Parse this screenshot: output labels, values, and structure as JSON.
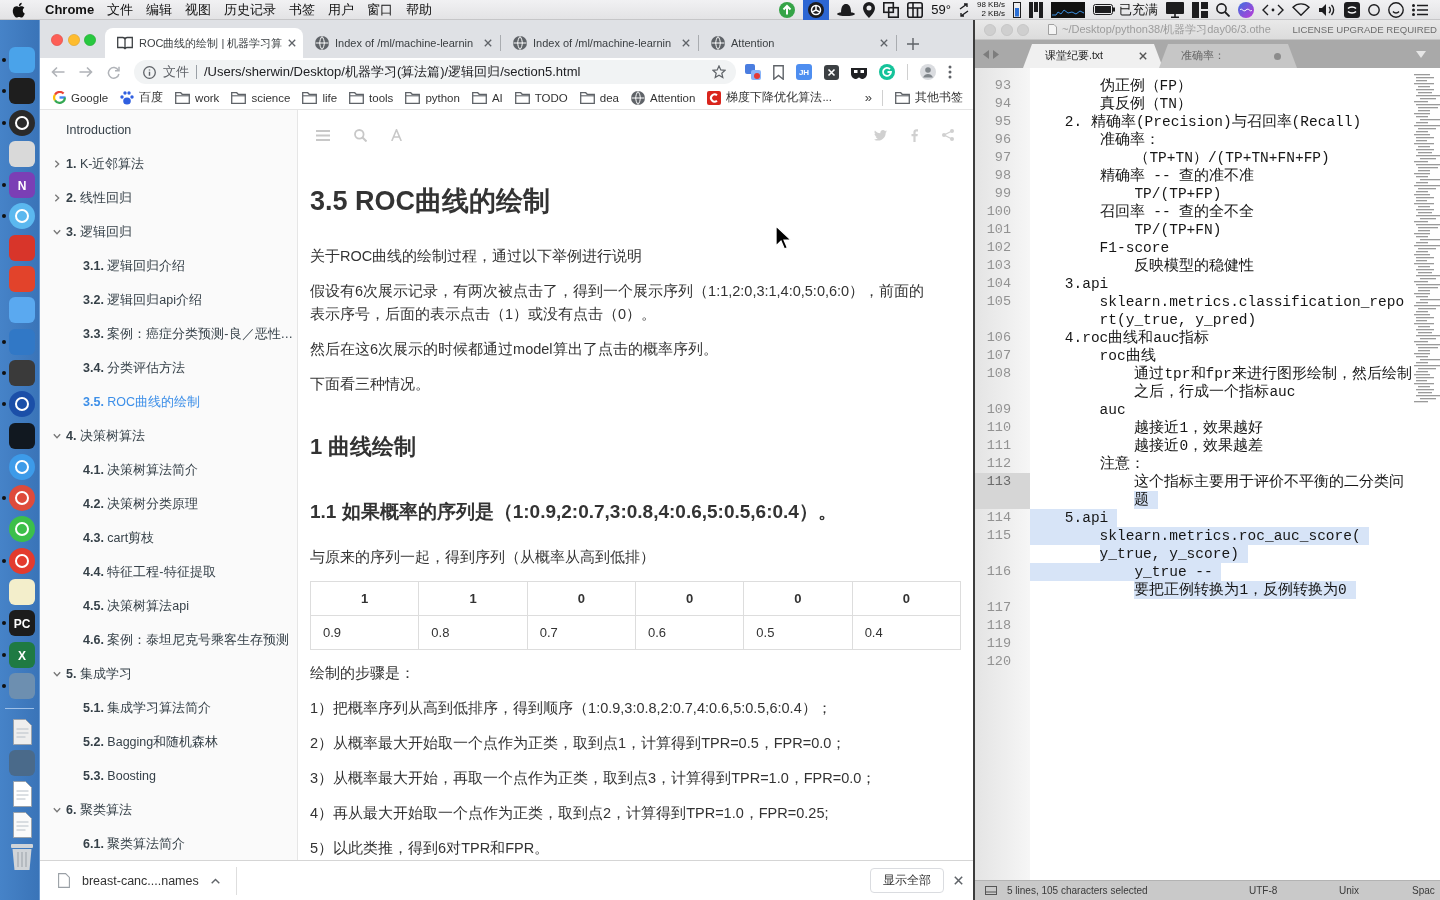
{
  "menubar": {
    "app": "Chrome",
    "menus": [
      "文件",
      "编辑",
      "视图",
      "历史记录",
      "书签",
      "用户",
      "窗口",
      "帮助"
    ],
    "status_items": [
      {
        "kind": "upload",
        "selected": false
      },
      {
        "kind": "aperture",
        "selected": true
      },
      {
        "kind": "hat",
        "selected": false
      },
      {
        "kind": "pin",
        "selected": false
      },
      {
        "kind": "windows",
        "selected": false
      },
      {
        "kind": "grid",
        "selected": false
      },
      {
        "kind": "temperature",
        "text": "59°",
        "selected": false
      },
      {
        "kind": "arrows",
        "selected": false
      },
      {
        "kind": "netspeed",
        "lines": [
          "98 KB/s",
          "2 KB/s"
        ],
        "selected": false
      },
      {
        "kind": "memory",
        "selected": false
      },
      {
        "kind": "bars",
        "selected": false
      },
      {
        "kind": "cpu",
        "selected": false
      },
      {
        "kind": "battery",
        "text": "已充满",
        "selected": false
      },
      {
        "kind": "display",
        "selected": false
      },
      {
        "kind": "layout",
        "selected": false
      },
      {
        "kind": "search",
        "selected": false
      },
      {
        "kind": "orb",
        "selected": false
      },
      {
        "kind": "code",
        "selected": false
      },
      {
        "kind": "wifi",
        "selected": false
      },
      {
        "kind": "volume",
        "selected": false
      },
      {
        "kind": "tile",
        "selected": false
      },
      {
        "kind": "ring",
        "selected": false
      },
      {
        "kind": "face",
        "selected": false
      },
      {
        "kind": "list",
        "selected": false
      }
    ]
  },
  "dock": {
    "apps": [
      {
        "kind": "tile",
        "color": "#4aa3ea",
        "running": true
      },
      {
        "kind": "tile",
        "color": "#1e1e1e",
        "running": true
      },
      {
        "kind": "disc",
        "color": "#2a2a2a",
        "running": true
      },
      {
        "kind": "tile",
        "color": "#d9d9d9",
        "running": false
      },
      {
        "kind": "tile",
        "color": "#7b3fb5",
        "glyph": "N",
        "running": true
      },
      {
        "kind": "disc",
        "color": "#5bb8ef",
        "running": true
      },
      {
        "kind": "tile",
        "color": "#d8352a",
        "running": false
      },
      {
        "kind": "tile",
        "color": "#e2432b",
        "running": false
      },
      {
        "kind": "tile",
        "color": "#5aa9f0",
        "running": false
      },
      {
        "kind": "tile",
        "color": "#3178c6",
        "running": true
      },
      {
        "kind": "tile",
        "color": "#3a3a3a",
        "running": true
      },
      {
        "kind": "disc",
        "color": "#1b4fa8",
        "running": true
      },
      {
        "kind": "tile",
        "color": "#111820",
        "running": false
      },
      {
        "kind": "disc",
        "color": "#3d9be9",
        "running": false
      },
      {
        "kind": "disc",
        "color": "#de4b3b",
        "running": true
      },
      {
        "kind": "disc",
        "color": "#3cbf4a",
        "running": false
      },
      {
        "kind": "disc",
        "color": "#e33b2e",
        "running": true
      },
      {
        "kind": "tile",
        "color": "#f3eecb",
        "running": false
      },
      {
        "kind": "tile",
        "color": "#1c1c1c",
        "glyph": "PC",
        "running": true
      },
      {
        "kind": "tile",
        "color": "#1f7a43",
        "glyph": "X",
        "running": true
      },
      {
        "kind": "tile",
        "color": "#6d8fb0",
        "running": true
      }
    ],
    "stacks": [
      {
        "kind": "page",
        "color": "#eeeeee"
      },
      {
        "kind": "tile",
        "color": "#4a6a8a"
      },
      {
        "kind": "page",
        "color": "#ffffff"
      },
      {
        "kind": "page",
        "color": "#fafafa"
      },
      {
        "kind": "trash",
        "color": "#d0d4d8"
      }
    ]
  },
  "chrome": {
    "tabs": [
      {
        "kind": "book",
        "title": "ROC曲线的绘制 | 机器学习算",
        "selected": true
      },
      {
        "kind": "globe",
        "title": "Index of /ml/machine-learnin",
        "selected": false
      },
      {
        "kind": "globe",
        "title": "Index of /ml/machine-learnin",
        "selected": false
      },
      {
        "kind": "globe",
        "title": "Attention",
        "selected": false
      }
    ],
    "address": {
      "scheme": "文件",
      "url": "/Users/sherwin/Desktop/机器学习(算法篇)/逻辑回归/section5.html"
    },
    "extensions": [
      {
        "kind": "squares"
      },
      {
        "kind": "bookmark"
      },
      {
        "kind": "initials",
        "label": "JH"
      },
      {
        "kind": "xsquare"
      },
      {
        "kind": "mask"
      },
      {
        "kind": "ring"
      }
    ],
    "bookmarks": [
      {
        "kind": "google",
        "title": "Google"
      },
      {
        "kind": "paw",
        "title": "百度"
      },
      {
        "kind": "folder",
        "title": "work"
      },
      {
        "kind": "folder",
        "title": "science"
      },
      {
        "kind": "folder",
        "title": "life"
      },
      {
        "kind": "folder",
        "title": "tools"
      },
      {
        "kind": "folder",
        "title": "python"
      },
      {
        "kind": "folder",
        "title": "AI"
      },
      {
        "kind": "folder",
        "title": "TODO"
      },
      {
        "kind": "folder",
        "title": "dea"
      },
      {
        "kind": "globe",
        "title": "Attention"
      },
      {
        "kind": "clogo",
        "title": "梯度下降优化算法..."
      }
    ],
    "bookmarks_overflow": "»",
    "other_bookmarks": "其他书签",
    "sidebar": [
      {
        "title": "Introduction",
        "selected": false
      },
      {
        "number": "1.",
        "title": "K-近邻算法",
        "selected": false,
        "expanded": false
      },
      {
        "number": "2.",
        "title": "线性回归",
        "selected": false,
        "expanded": false
      },
      {
        "number": "3.",
        "title": "逻辑回归",
        "selected": false,
        "expanded": true,
        "children": [
          {
            "number": "3.1.",
            "title": "逻辑回归介绍",
            "selected": false
          },
          {
            "number": "3.2.",
            "title": "逻辑回归api介绍",
            "selected": false
          },
          {
            "number": "3.3.",
            "title": "案例：癌症分类预测-良／恶性…",
            "selected": false
          },
          {
            "number": "3.4.",
            "title": "分类评估方法",
            "selected": false
          },
          {
            "number": "3.5.",
            "title": "ROC曲线的绘制",
            "selected": true
          }
        ]
      },
      {
        "number": "4.",
        "title": "决策树算法",
        "selected": false,
        "expanded": true,
        "children": [
          {
            "number": "4.1.",
            "title": "决策树算法简介",
            "selected": false
          },
          {
            "number": "4.2.",
            "title": "决策树分类原理",
            "selected": false
          },
          {
            "number": "4.3.",
            "title": "cart剪枝",
            "selected": false
          },
          {
            "number": "4.4.",
            "title": "特征工程-特征提取",
            "selected": false
          },
          {
            "number": "4.5.",
            "title": "决策树算法api",
            "selected": false
          },
          {
            "number": "4.6.",
            "title": "案例：泰坦尼克号乘客生存预测",
            "selected": false
          }
        ]
      },
      {
        "number": "5.",
        "title": "集成学习",
        "selected": false,
        "expanded": true,
        "children": [
          {
            "number": "5.1.",
            "title": "集成学习算法简介",
            "selected": false
          },
          {
            "number": "5.2.",
            "title": "Bagging和随机森林",
            "selected": false
          },
          {
            "number": "5.3.",
            "title": "Boosting",
            "selected": false
          }
        ]
      },
      {
        "number": "6.",
        "title": "聚类算法",
        "selected": false,
        "expanded": true,
        "children": [
          {
            "number": "6.1.",
            "title": "聚类算法简介",
            "selected": false
          }
        ]
      }
    ],
    "article": {
      "title": "3.5 ROC曲线的绘制",
      "blocks": [
        {
          "kind": "paragraph",
          "text": "关于ROC曲线的绘制过程，通过以下举例进行说明"
        },
        {
          "kind": "paragraph",
          "text": "假设有6次展示记录，有两次被点击了，得到一个展示序列（1:1,2:0,3:1,4:0,5:0,6:0），前面的表示序号，后面的表示点击（1）或没有点击（0）。"
        },
        {
          "kind": "paragraph",
          "text": "然后在这6次展示的时候都通过model算出了点击的概率序列。"
        },
        {
          "kind": "paragraph",
          "text": "下面看三种情况。"
        },
        {
          "kind": "heading2",
          "text": "1 曲线绘制"
        },
        {
          "kind": "heading3",
          "text": "1.1 如果概率的序列是（1:0.9,2:0.7,3:0.8,4:0.6,5:0.5,6:0.4）。"
        },
        {
          "kind": "paragraph",
          "text": "与原来的序列一起，得到序列（从概率从高到低排）"
        },
        {
          "kind": "table",
          "header": [
            "1",
            "1",
            "0",
            "0",
            "0",
            "0"
          ],
          "rows": [
            [
              "0.9",
              "0.8",
              "0.7",
              "0.6",
              "0.5",
              "0.4"
            ]
          ]
        },
        {
          "kind": "paragraph",
          "text": "绘制的步骤是："
        },
        {
          "kind": "paragraph",
          "text": "1）把概率序列从高到低排序，得到顺序（1:0.9,3:0.8,2:0.7,4:0.6,5:0.5,6:0.4）；"
        },
        {
          "kind": "paragraph",
          "text": "2）从概率最大开始取一个点作为正类，取到点1，计算得到TPR=0.5，FPR=0.0；"
        },
        {
          "kind": "paragraph",
          "text": "3）从概率最大开始，再取一个点作为正类，取到点3，计算得到TPR=1.0，FPR=0.0；"
        },
        {
          "kind": "paragraph",
          "text": "4）再从最大开始取一个点作为正类，取到点2，计算得到TPR=1.0，FPR=0.25;"
        },
        {
          "kind": "paragraph",
          "text": "5）以此类推，得到6对TPR和FPR。"
        }
      ]
    },
    "download": {
      "file": "breast-canc....names",
      "show_all": "显示全部"
    }
  },
  "sublime": {
    "title": "~/Desktop/python38/机器学习day06/3.othe",
    "license": "LICENSE UPGRADE REQUIRED",
    "tabs": [
      {
        "title": "课堂纪要.txt",
        "selected": true,
        "dirty": false
      },
      {
        "title": "准确率：",
        "selected": false,
        "dirty": true
      }
    ],
    "lines": [
      {
        "number": "93",
        "current": false,
        "rows": [
          {
            "text": "\t\t伪正例（FP）",
            "selected": false
          }
        ]
      },
      {
        "number": "94",
        "current": false,
        "rows": [
          {
            "text": "\t\t真反例（TN）",
            "selected": false
          }
        ]
      },
      {
        "number": "95",
        "current": false,
        "rows": [
          {
            "text": "\t2. 精确率(Precision)与召回率(Recall)",
            "selected": false
          }
        ]
      },
      {
        "number": "96",
        "current": false,
        "rows": [
          {
            "text": "\t\t准确率：",
            "selected": false
          }
        ]
      },
      {
        "number": "97",
        "current": false,
        "rows": [
          {
            "text": "\t\t\t（TP+TN）/(TP+TN+FN+FP)",
            "selected": false
          }
        ]
      },
      {
        "number": "98",
        "current": false,
        "rows": [
          {
            "text": "\t\t精确率 -- 查的准不准",
            "selected": false
          }
        ]
      },
      {
        "number": "99",
        "current": false,
        "rows": [
          {
            "text": "\t\t\tTP/(TP+FP)",
            "selected": false
          }
        ]
      },
      {
        "number": "100",
        "current": false,
        "rows": [
          {
            "text": "\t\t召回率 -- 查的全不全",
            "selected": false
          }
        ]
      },
      {
        "number": "101",
        "current": false,
        "rows": [
          {
            "text": "\t\t\tTP/(TP+FN)",
            "selected": false
          }
        ]
      },
      {
        "number": "102",
        "current": false,
        "rows": [
          {
            "text": "\t\tF1-score",
            "selected": false
          }
        ]
      },
      {
        "number": "103",
        "current": false,
        "rows": [
          {
            "text": "\t\t\t反映模型的稳健性",
            "selected": false
          }
        ]
      },
      {
        "number": "104",
        "current": false,
        "rows": [
          {
            "text": "\t3.api",
            "selected": false
          }
        ]
      },
      {
        "number": "105",
        "current": false,
        "rows": [
          {
            "text": "\t\tsklearn.metrics.classification_repo",
            "selected": false
          },
          {
            "text": "rt(y_true, y_pred)",
            "selected": false
          }
        ]
      },
      {
        "number": "106",
        "current": false,
        "rows": [
          {
            "text": "\t4.roc曲线和auc指标",
            "selected": false
          }
        ]
      },
      {
        "number": "107",
        "current": false,
        "rows": [
          {
            "text": "\t\troc曲线",
            "selected": false
          }
        ]
      },
      {
        "number": "108",
        "current": false,
        "rows": [
          {
            "text": "\t\t\t通过tpr和fpr来进行图形绘制，然后绘制",
            "selected": false
          },
          {
            "text": "之后，行成一个指标auc",
            "selected": false
          }
        ]
      },
      {
        "number": "109",
        "current": false,
        "rows": [
          {
            "text": "\t\tauc",
            "selected": false
          }
        ]
      },
      {
        "number": "110",
        "current": false,
        "rows": [
          {
            "text": "\t\t\t越接近1，效果越好",
            "selected": false
          }
        ]
      },
      {
        "number": "111",
        "current": false,
        "rows": [
          {
            "text": "\t\t\t越接近0，效果越差",
            "selected": false
          }
        ]
      },
      {
        "number": "112",
        "current": false,
        "rows": [
          {
            "text": "\t\t注意：",
            "selected": false
          }
        ]
      },
      {
        "number": "113",
        "current": true,
        "rows": [
          {
            "text": "\t\t\t这个指标主要用于评价不平衡的二分类问",
            "selected": false
          },
          {
            "text": "题",
            "selected": true
          }
        ]
      },
      {
        "number": "114",
        "current": false,
        "rows": [
          {
            "text": "\t5.api",
            "selected": true
          }
        ]
      },
      {
        "number": "115",
        "current": false,
        "rows": [
          {
            "text": "\t\tsklearn.metrics.roc_auc_score(",
            "selected": true
          },
          {
            "text": "y_true, y_score)",
            "selected": true
          }
        ]
      },
      {
        "number": "116",
        "current": false,
        "rows": [
          {
            "text": "\t\t\ty_true --",
            "selected": true
          },
          {
            "text": "要把正例转换为1，反例转换为0",
            "selected": true
          }
        ]
      },
      {
        "number": "117",
        "current": false
      },
      {
        "number": "118",
        "current": false
      },
      {
        "number": "119",
        "current": false
      },
      {
        "number": "120",
        "current": false
      }
    ],
    "status": {
      "selection": "5 lines, 105 characters selected",
      "encoding": "UTF-8",
      "line_endings": "Unix",
      "indentation": "Spac"
    }
  }
}
